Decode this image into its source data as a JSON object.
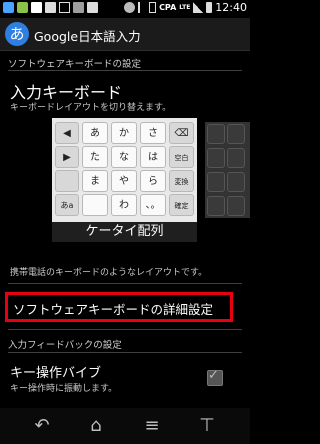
{
  "status_bar": {
    "carrier": "CPA",
    "network": "LTE",
    "time": "12:40",
    "icons": [
      "notification-icon",
      "app-icon",
      "gmail-icon",
      "n-icon",
      "download-icon",
      "image-icon",
      "n-icon",
      "nfc-icon",
      "bluetooth-icon",
      "vibrate-icon",
      "battery-icon"
    ]
  },
  "action_bar": {
    "app_icon_text": "あ",
    "title": "Google日本語入力"
  },
  "section_software_keyboard": "ソフトウェアキーボードの設定",
  "input_keyboard": {
    "title": "入力キーボード",
    "summary": "キーボードレイアウトを切り替えます。"
  },
  "keyboard_preview": {
    "keys": [
      [
        "◀",
        "あ",
        "か",
        "さ",
        "⌫"
      ],
      [
        "▶",
        "た",
        "な",
        "は",
        "空白"
      ],
      [
        "",
        "ま",
        "や",
        "ら",
        "変換"
      ],
      [
        "あa",
        "",
        "わ",
        "、。",
        "確定"
      ]
    ],
    "layout_label": "ケータイ配列"
  },
  "layout_description": "携帯電話のキーボードのようなレイアウトです。",
  "detail_settings_label": "ソフトウェアキーボードの詳細設定",
  "section_input_feedback": "入力フィードバックの設定",
  "key_vibrate": {
    "title": "キー操作バイブ",
    "summary": "キー操作時に振動します。",
    "checked": true
  },
  "navigation": [
    "back-icon",
    "home-icon",
    "menu-icon",
    "recent-apps-icon"
  ]
}
